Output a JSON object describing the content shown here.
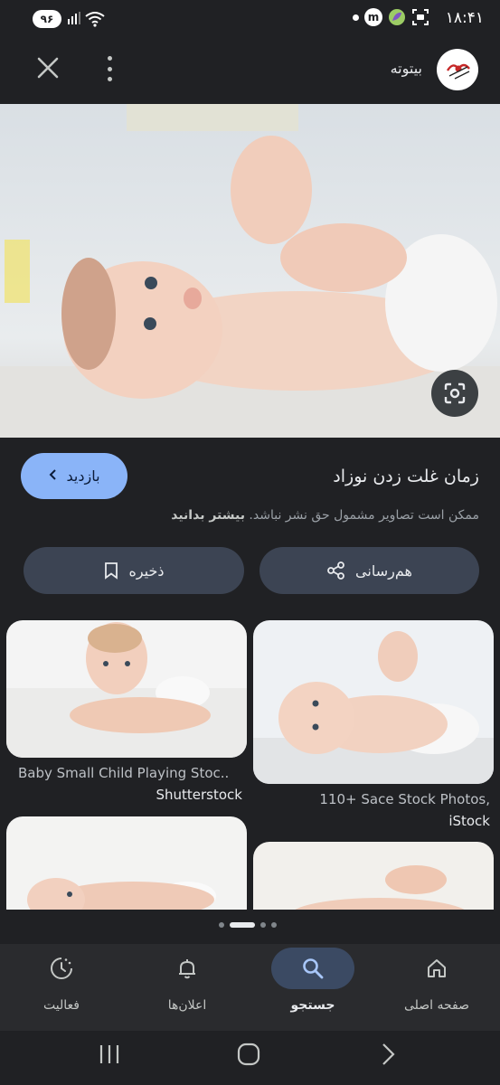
{
  "status_bar": {
    "time": "۱۸:۴۱",
    "battery": "۹۶"
  },
  "header": {
    "site_name": "بیتوته",
    "site_logo_icon": "bitoote-logo-icon"
  },
  "image": {
    "alt": "baby lying on back holding feet"
  },
  "info": {
    "visit_label": "بازدید",
    "title": "زمان غلت زدن نوزاد",
    "notice": "ممکن است تصاویر مشمول حق نشر نباشد.",
    "learn_more": "بیشتر بدانید"
  },
  "actions": {
    "share_label": "هم‌رسانی",
    "save_label": "ذخیره"
  },
  "results": [
    {
      "caption": "110+ Sace Stock Photos,",
      "source": "iStock"
    },
    {
      "caption": "Baby Small Child Playing Stoc..",
      "source": "Shutterstock"
    }
  ],
  "bottom_nav": [
    {
      "label": "صفحه اصلی",
      "icon": "home-icon"
    },
    {
      "label": "جستجو",
      "icon": "search-icon",
      "active": true
    },
    {
      "label": "اعلان‌ها",
      "icon": "bell-icon"
    },
    {
      "label": "فعالیت",
      "icon": "activity-icon"
    }
  ],
  "colors": {
    "accent": "#8ab4f8",
    "background": "#202124",
    "pill": "#3c4453"
  }
}
